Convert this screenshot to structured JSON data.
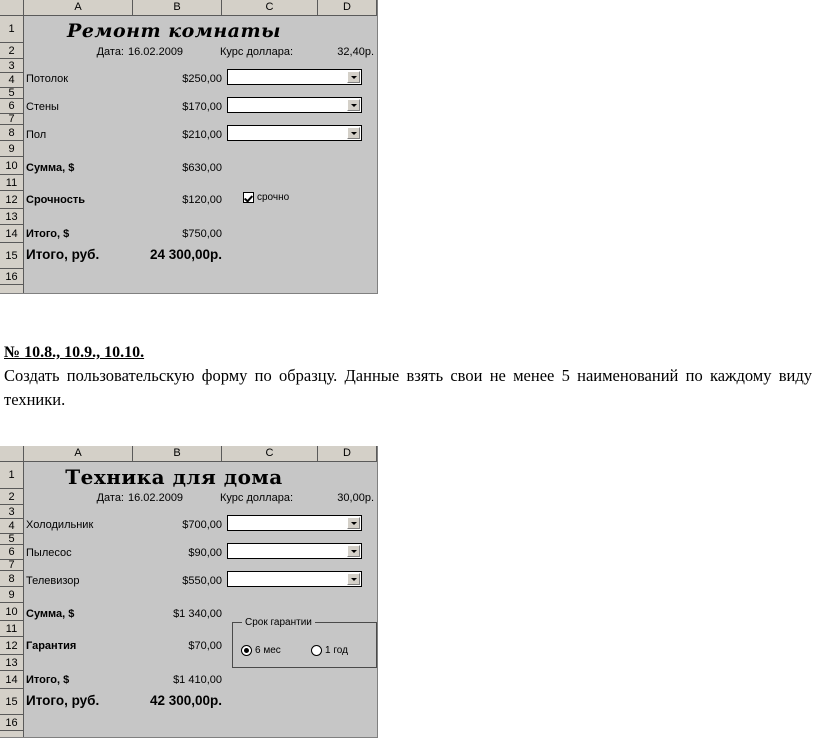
{
  "document": {
    "task": {
      "heading": "№ 10.8.,  10.9., 10.10.",
      "body": "Создать пользовательскую форму по образцу. Данные взять свои не менее 5 наименований по каждому виду техники."
    }
  },
  "columns": [
    "A",
    "B",
    "C",
    "D"
  ],
  "row_numbers": [
    "1",
    "2",
    "3",
    "4",
    "5",
    "6",
    "7",
    "8",
    "9",
    "10",
    "11",
    "12",
    "13",
    "14",
    "15",
    "16"
  ],
  "sheet1": {
    "title": "Ремонт комнаты",
    "date_label": "Дата:",
    "date_value": "16.02.2009",
    "rate_label": "Курс доллара:",
    "rate_value": "32,40р.",
    "items": [
      {
        "name": "Потолок",
        "price": "$250,00"
      },
      {
        "name": "Стены",
        "price": "$170,00"
      },
      {
        "name": "Пол",
        "price": "$210,00"
      }
    ],
    "sum_label": "Сумма, $",
    "sum_value": "$630,00",
    "extra_label": "Срочность",
    "extra_value": "$120,00",
    "checkbox_label": "срочно",
    "checkbox_checked": true,
    "total_usd_label": "Итого, $",
    "total_usd_value": "$750,00",
    "total_rub_label": "Итого, руб.",
    "total_rub_value": "24 300,00р."
  },
  "sheet2": {
    "title": "Техника  для  дома",
    "date_label": "Дата:",
    "date_value": "16.02.2009",
    "rate_label": "Курс доллара:",
    "rate_value": "30,00р.",
    "items": [
      {
        "name": "Холодильник",
        "price": "$700,00"
      },
      {
        "name": "Пылесос",
        "price": "$90,00"
      },
      {
        "name": "Телевизор",
        "price": "$550,00"
      }
    ],
    "sum_label": "Сумма, $",
    "sum_value": "$1 340,00",
    "extra_label": "Гарантия",
    "extra_value": "$70,00",
    "fieldset_legend": "Срок гарантии",
    "radio_1_label": "6 мес",
    "radio_2_label": "1 год",
    "radio_selected": 1,
    "total_usd_label": "Итого, $",
    "total_usd_value": "$1 410,00",
    "total_rub_label": "Итого, руб.",
    "total_rub_value": "42 300,00р."
  }
}
